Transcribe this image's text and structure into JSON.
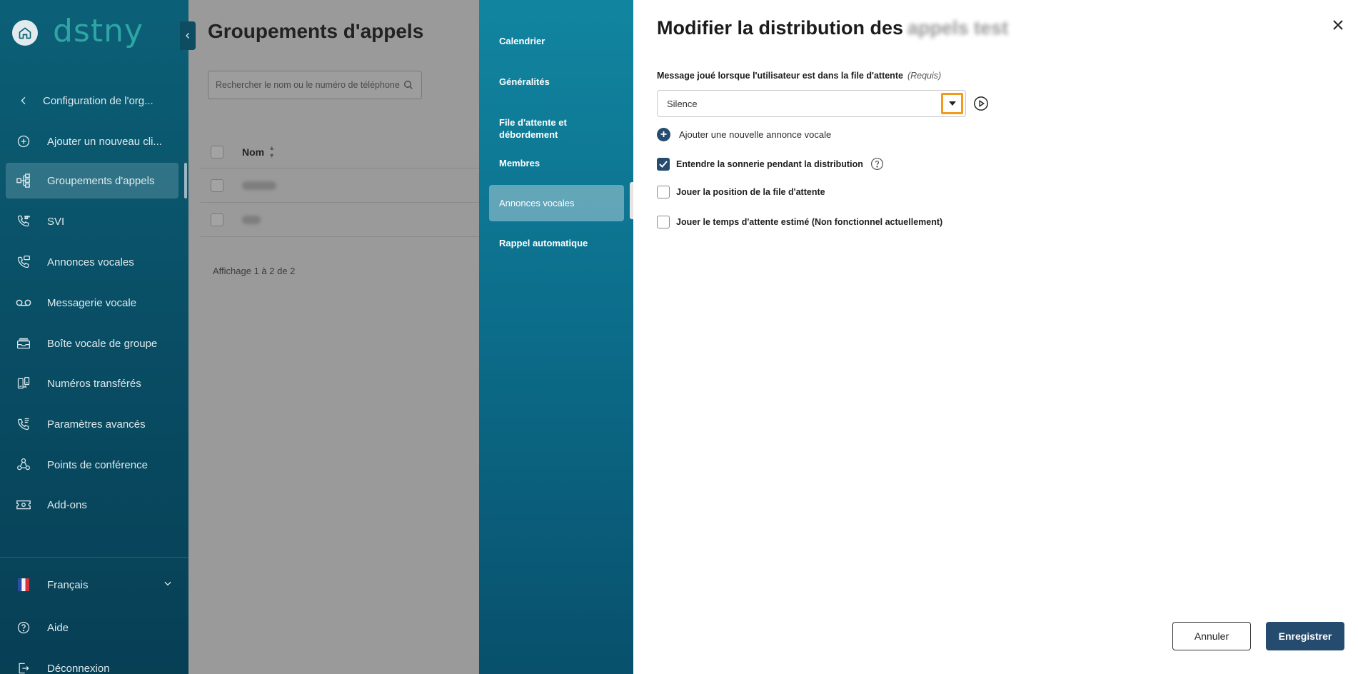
{
  "sidebar": {
    "logo": "dstny",
    "items": [
      {
        "label": "Configuration de l'org...",
        "icon": "chevron-left-icon"
      },
      {
        "label": "Ajouter un nouveau cli...",
        "icon": "plus-circle-icon"
      },
      {
        "label": "Groupements d'appels",
        "icon": "hierarchy-icon",
        "active": true
      },
      {
        "label": "SVI",
        "icon": "phone-keypad-icon"
      },
      {
        "label": "Annonces vocales",
        "icon": "phone-message-icon"
      },
      {
        "label": "Messagerie vocale",
        "icon": "voicemail-icon"
      },
      {
        "label": "Boîte vocale de groupe",
        "icon": "inbox-icon"
      },
      {
        "label": "Numéros transférés",
        "icon": "phone-transfer-icon"
      },
      {
        "label": "Paramètres avancés",
        "icon": "phone-settings-icon"
      },
      {
        "label": "Points de conférence",
        "icon": "conference-icon"
      },
      {
        "label": "Add-ons",
        "icon": "ticket-icon"
      }
    ],
    "language": "Français",
    "help": "Aide",
    "logout": "Déconnexion"
  },
  "main": {
    "title": "Groupements d'appels",
    "search_placeholder": "Rechercher le nom ou le numéro de téléphone",
    "column_name": "Nom",
    "paging": "Affichage 1 à 2 de 2"
  },
  "sections": [
    {
      "label": "Calendrier"
    },
    {
      "label": "Généralités"
    },
    {
      "label": "File d'attente et débordement"
    },
    {
      "label": "Membres"
    },
    {
      "label": "Annonces vocales",
      "active": true
    },
    {
      "label": "Rappel automatique"
    }
  ],
  "drawer": {
    "title": "Modifier la distribution des",
    "title_blurred": "appels test",
    "field_label": "Message joué lorsque l'utilisateur est dans la file d'attente",
    "field_required": "(Requis)",
    "select_value": "Silence",
    "add_announcement": "Ajouter une nouvelle annonce vocale",
    "options": [
      {
        "label": "Entendre la sonnerie pendant la distribution",
        "checked": true
      },
      {
        "label": "Jouer la position de la file d'attente",
        "checked": false
      },
      {
        "label": "Jouer le temps d'attente estimé (Non fonctionnel actuellement)",
        "checked": false
      }
    ],
    "cancel_label": "Annuler",
    "save_label": "Enregistrer"
  },
  "colors": {
    "sidebar_bg": "#0b6077",
    "section_bg": "#1185a0",
    "primary_button": "#254b6e",
    "highlight_orange": "#f39a1e",
    "logo": "#2fa6a3"
  }
}
